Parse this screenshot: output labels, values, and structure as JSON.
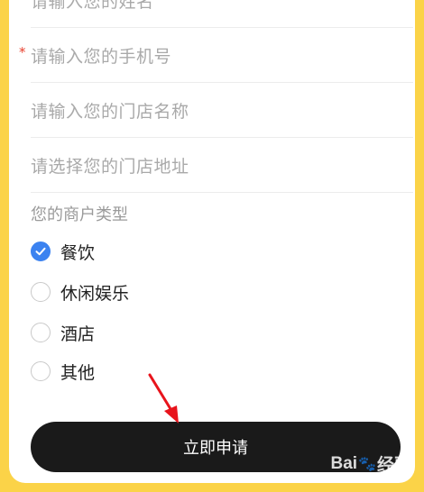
{
  "form": {
    "name_placeholder": "请输入您的姓名",
    "phone_placeholder": "请输入您的手机号",
    "phone_required_mark": "*",
    "store_name_placeholder": "请输入您的门店名称",
    "store_address_placeholder": "请选择您的门店地址",
    "merchant_type_label": "您的商户类型",
    "merchant_types": [
      {
        "label": "餐饮",
        "checked": true
      },
      {
        "label": "休闲娱乐",
        "checked": false
      },
      {
        "label": "酒店",
        "checked": false
      },
      {
        "label": "其他",
        "checked": false
      }
    ],
    "submit_label": "立即申请"
  },
  "watermark": {
    "left": "Bai",
    "right": "经验"
  },
  "colors": {
    "background": "#fbd348",
    "accent": "#3b82f0",
    "required": "#e8412f",
    "button": "#1a1a1a",
    "annotation_arrow": "#e8141c"
  },
  "icons": {
    "checked": "check-icon",
    "annotation": "red-arrow-icon",
    "watermark": "baidu-paw-icon"
  }
}
